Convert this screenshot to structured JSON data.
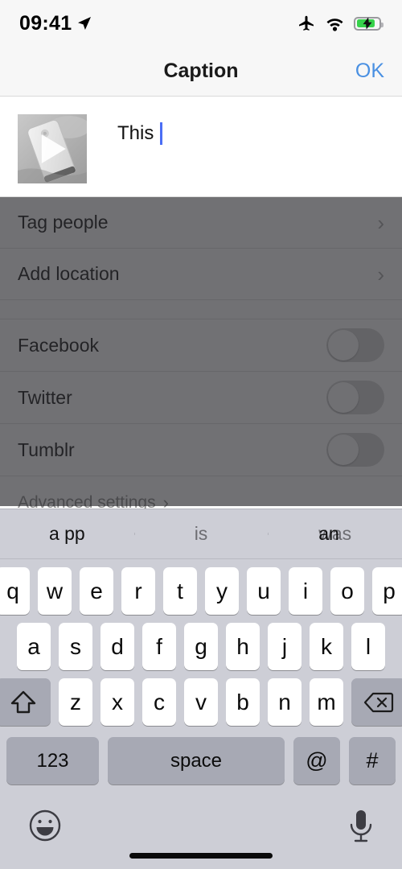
{
  "status_bar": {
    "time": "09:41",
    "location_icon": "location-arrow-icon",
    "airplane_icon": "airplane-mode-icon",
    "wifi_icon": "wifi-icon",
    "battery_icon": "battery-charging-icon",
    "battery_level_percent": 85,
    "battery_color": "#37d24b"
  },
  "nav": {
    "title": "Caption",
    "ok_label": "OK",
    "ok_color": "#4a90e2"
  },
  "caption": {
    "text": "This ",
    "thumbnail_name": "video-thumbnail",
    "play_icon": "play-triangle-icon",
    "caret_color": "#4b6ef5"
  },
  "options": {
    "rows": [
      {
        "label": "Tag people",
        "type": "disclosure",
        "chevron": "›"
      },
      {
        "label": "Add location",
        "type": "disclosure",
        "chevron": "›"
      }
    ],
    "toggles": [
      {
        "label": "Facebook",
        "on": false
      },
      {
        "label": "Twitter",
        "on": false
      },
      {
        "label": "Tumblr",
        "on": false
      }
    ],
    "advanced": {
      "label": "Advanced settings",
      "chevron": "›"
    },
    "dim_color": "#282830"
  },
  "keyboard": {
    "predictions": [
      {
        "text": "a pp",
        "highlight": true
      },
      {
        "text": "is",
        "highlight": false
      },
      {
        "text": "an",
        "overlay": "was",
        "highlight": false
      }
    ],
    "row1": [
      "q",
      "w",
      "e",
      "r",
      "t",
      "y",
      "u",
      "i",
      "o",
      "p"
    ],
    "row2": [
      "a",
      "s",
      "d",
      "f",
      "g",
      "h",
      "j",
      "k",
      "l"
    ],
    "row3": [
      "z",
      "x",
      "c",
      "v",
      "b",
      "n",
      "m"
    ],
    "shift_icon": "shift-arrow-icon",
    "backspace_icon": "backspace-delete-icon",
    "numbers_label": "123",
    "space_label": "space",
    "at_label": "@",
    "hash_label": "#",
    "emoji_icon": "emoji-smiley-icon",
    "dictation_icon": "microphone-icon",
    "key_bg": "#ffffff",
    "fn_key_bg": "#a7a9b4",
    "keyboard_bg": "#cdced6"
  }
}
